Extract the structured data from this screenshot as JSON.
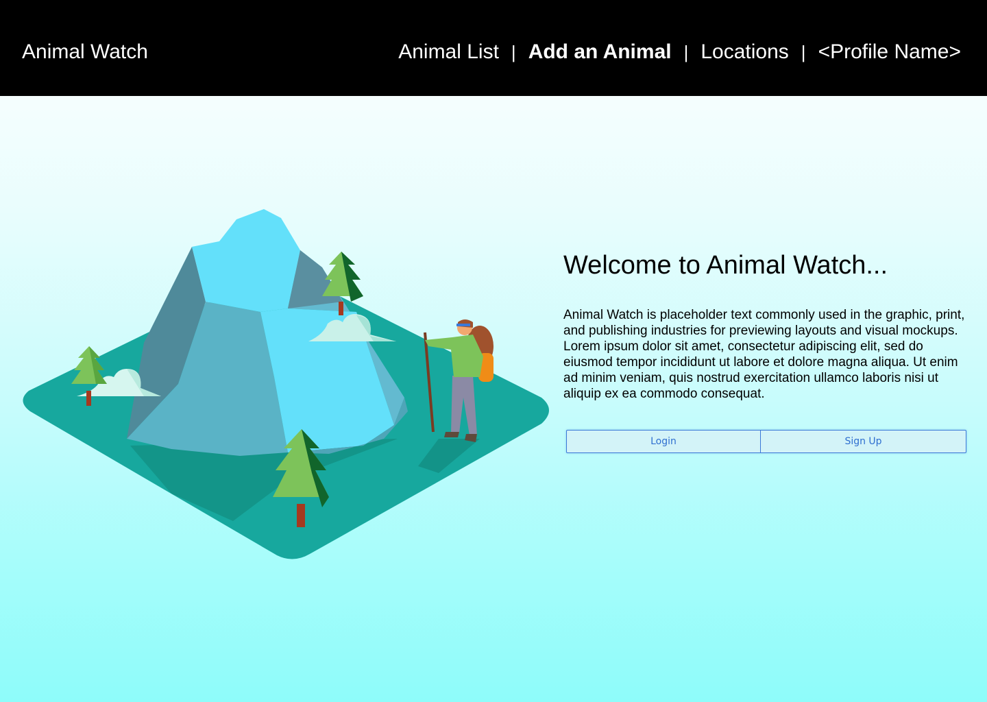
{
  "header": {
    "brand": "Animal Watch",
    "nav": [
      {
        "label": "Animal List",
        "active": false
      },
      {
        "label": "Add an Animal",
        "active": true
      },
      {
        "label": "Locations",
        "active": false
      },
      {
        "label": "<Profile Name>",
        "active": false
      }
    ],
    "separator": "|"
  },
  "main": {
    "title": "Welcome to Animal Watch...",
    "description": "Animal Watch is placeholder text commonly used in the graphic, print, and publishing industries for previewing layouts and visual mockups. Lorem ipsum dolor sit amet, consectetur adipiscing elit, sed do eiusmod tempor incididunt ut labore et dolore magna aliqua. Ut enim ad minim veniam, quis nostrud exercitation ullamco laboris nisi ut aliquip ex ea commodo consequat.",
    "buttons": {
      "login": "Login",
      "signup": "Sign Up"
    }
  },
  "illustration": {
    "icon": "mountain-hiker-illustration"
  },
  "colors": {
    "header_bg": "#000000",
    "header_text": "#ffffff",
    "ground": "#17a89e",
    "mountain_light": "#63e0fa",
    "mountain_mid": "#5ab3c6",
    "mountain_dark": "#4f8a9a",
    "tree": "#7dc35a",
    "button_text": "#2f6fd0",
    "button_border": "#3a78d8"
  }
}
